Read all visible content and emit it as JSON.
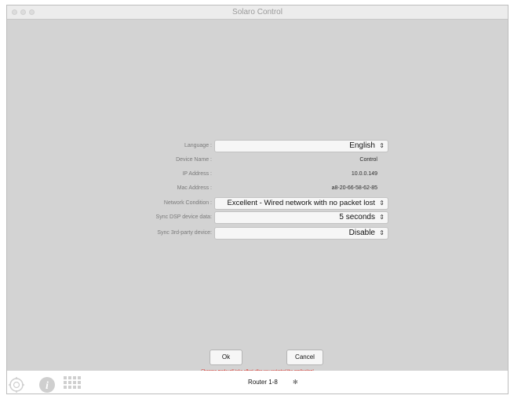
{
  "window": {
    "title": "Solaro Control"
  },
  "settings": {
    "language": {
      "label": "Language :",
      "value": "English"
    },
    "device_name": {
      "label": "Device Name :",
      "value": "Control"
    },
    "ip_address": {
      "label": "IP Address :",
      "value": "10.0.0.149"
    },
    "mac_address": {
      "label": "Mac Address :",
      "value": "a8-20-66-58-62-85"
    },
    "network_condition": {
      "label": "Network Condition :",
      "value": "Excellent - Wired network with no packet lost"
    },
    "sync_dsp": {
      "label": "Sync DSP device data:",
      "value": "5 seconds"
    },
    "sync_3rd": {
      "label": "Sync 3rd-party device:",
      "value": "Disable"
    }
  },
  "buttons": {
    "ok": "Ok",
    "cancel": "Cancel"
  },
  "notice": "Changes made will take effect after you restarted the application!",
  "bottom_bar": {
    "router": "Router 1-8",
    "star": "✻"
  },
  "select_arrows": "⇕",
  "icons": [
    "gear-icon",
    "info-icon",
    "grid-icon"
  ],
  "colors": {
    "background": "#d3d3d3",
    "notice": "#e0241b"
  }
}
